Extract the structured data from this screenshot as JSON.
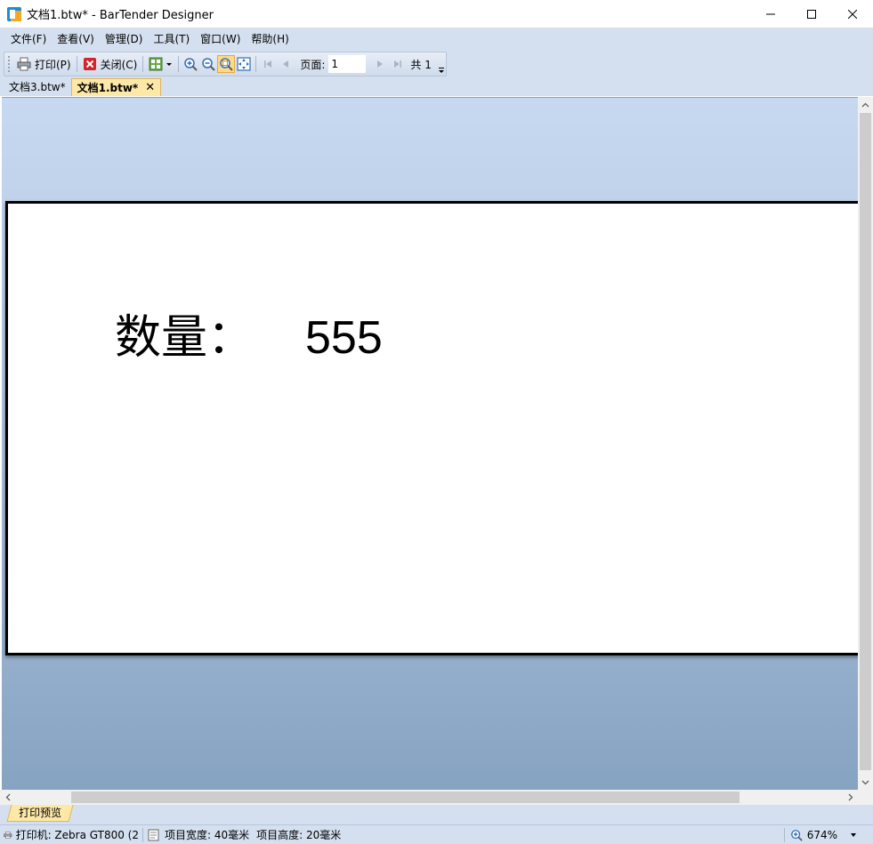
{
  "window": {
    "title": "文档1.btw* - BarTender Designer"
  },
  "menu": {
    "items": [
      {
        "label": "文件(F)"
      },
      {
        "label": "查看(V)"
      },
      {
        "label": "管理(D)"
      },
      {
        "label": "工具(T)"
      },
      {
        "label": "窗口(W)"
      },
      {
        "label": "帮助(H)"
      }
    ]
  },
  "toolbar": {
    "print_label": "打印(P)",
    "close_label": "关闭(C)",
    "page_label": "页面:",
    "page_value": "1",
    "total_label": "共 1"
  },
  "tabs": [
    {
      "label": "文档3.btw*",
      "active": false
    },
    {
      "label": "文档1.btw*",
      "active": true
    }
  ],
  "label_preview": {
    "field_label": "数量：",
    "field_value": "555"
  },
  "mode_tab": {
    "label": "打印预览"
  },
  "status": {
    "printer": "打印机: Zebra GT800 (2",
    "item_width": "项目宽度: 40毫米",
    "item_height": "项目高度: 20毫米",
    "zoom": "674%"
  },
  "colors": {
    "accent_tab": "#fde8a8",
    "chrome": "#d4e0ef"
  }
}
